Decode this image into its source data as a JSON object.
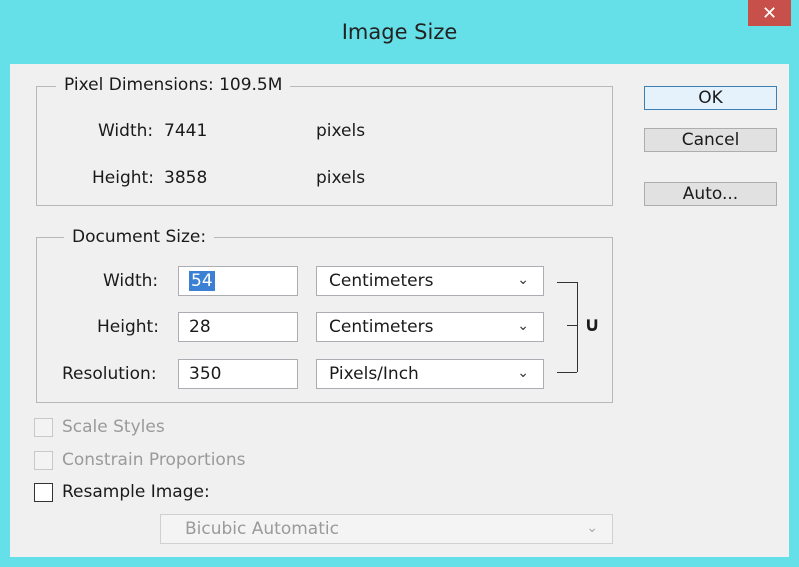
{
  "window": {
    "title": "Image Size",
    "close_glyph": "✕"
  },
  "pixel_dimensions": {
    "legend": "Pixel Dimensions:",
    "size": "109.5M",
    "width_label": "Width:",
    "width_value": "7441",
    "width_unit": "pixels",
    "height_label": "Height:",
    "height_value": "3858",
    "height_unit": "pixels"
  },
  "document_size": {
    "legend": "Document Size:",
    "width_label": "Width:",
    "width_value": "54",
    "width_unit": "Centimeters",
    "height_label": "Height:",
    "height_value": "28",
    "height_unit": "Centimeters",
    "resolution_label": "Resolution:",
    "resolution_value": "350",
    "resolution_unit": "Pixels/Inch"
  },
  "buttons": {
    "ok": "OK",
    "cancel": "Cancel",
    "auto": "Auto..."
  },
  "options": {
    "scale_styles": "Scale Styles",
    "constrain_proportions": "Constrain Proportions",
    "resample_image": "Resample Image:",
    "resample_method": "Bicubic Automatic"
  },
  "icons": {
    "chevron": "⌄",
    "link": "link-icon"
  },
  "colors": {
    "title_bar": "#66e0e8",
    "close": "#c7504a",
    "selection": "#3b80d4"
  }
}
